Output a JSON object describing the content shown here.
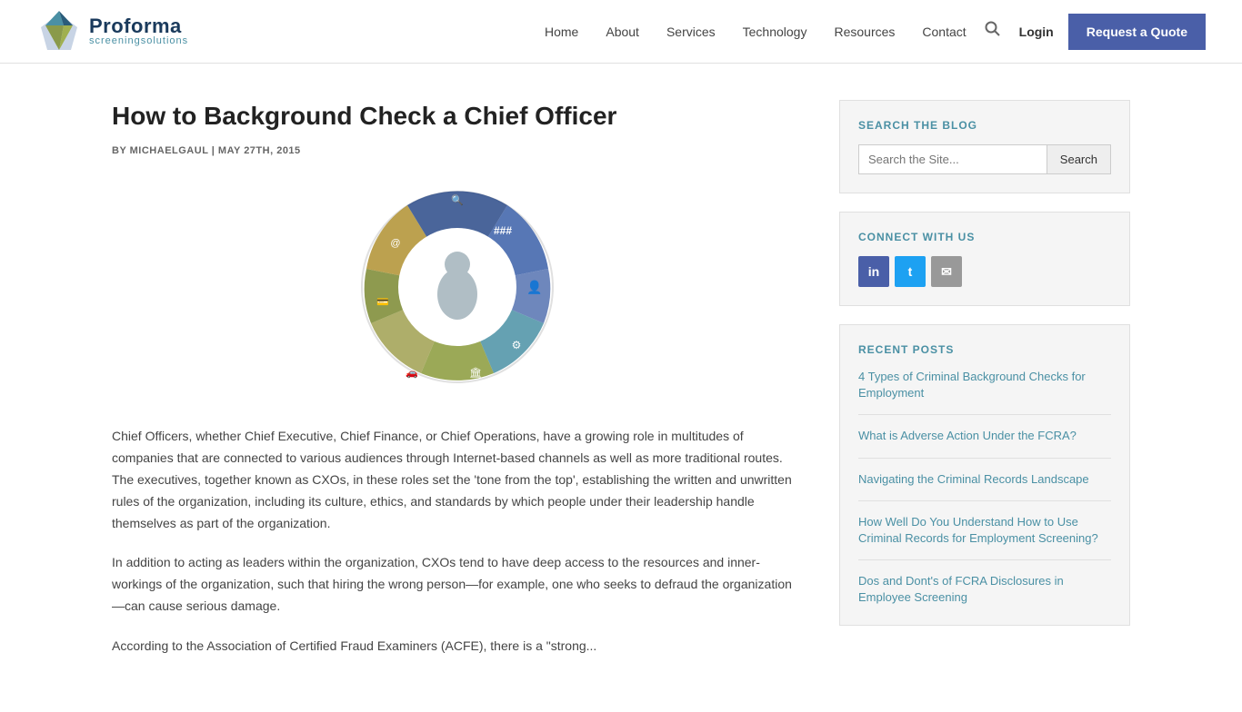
{
  "header": {
    "logo_name": "Proforma",
    "logo_sub_1": "screening",
    "logo_sub_2": "solutions",
    "nav": [
      {
        "label": "Home",
        "href": "#"
      },
      {
        "label": "About",
        "href": "#"
      },
      {
        "label": "Services",
        "href": "#"
      },
      {
        "label": "Technology",
        "href": "#"
      },
      {
        "label": "Resources",
        "href": "#"
      },
      {
        "label": "Contact",
        "href": "#"
      }
    ],
    "login_label": "Login",
    "quote_label": "Request a Quote"
  },
  "article": {
    "title": "How to Background Check a Chief Officer",
    "meta": "BY MICHAELGAUL | MAY 27TH, 2015",
    "body_1": "Chief Officers, whether Chief Executive, Chief Finance, or Chief Operations, have a growing role in multitudes of companies that are connected to various audiences through Internet-based channels as well as more traditional routes. The executives, together known as CXOs, in these roles set the 'tone from the top', establishing the written and unwritten rules of the organization, including its culture, ethics, and standards by which people under their leadership handle themselves as part of the organization.",
    "body_2": "In addition to acting as leaders within the organization, CXOs tend to have deep access to the resources and inner-workings of the organization, such that hiring the wrong person—for example, one who seeks to defraud the organization—can cause serious damage.",
    "body_3": "According to the Association of Certified Fraud Examiners (ACFE), there is a \"strong..."
  },
  "sidebar": {
    "search_section": {
      "title": "SEARCH THE BLOG",
      "placeholder": "Search the Site...",
      "button_label": "Search"
    },
    "connect_section": {
      "title": "CONNECT WITH US",
      "linkedin_label": "in",
      "twitter_label": "t",
      "email_label": "✉"
    },
    "recent_posts_section": {
      "title": "RECENT POSTS",
      "posts": [
        {
          "label": "4 Types of Criminal Background Checks for Employment",
          "href": "#"
        },
        {
          "label": "What is Adverse Action Under the FCRA?",
          "href": "#"
        },
        {
          "label": "Navigating the Criminal Records Landscape",
          "href": "#"
        },
        {
          "label": "How Well Do You Understand How to Use Criminal Records for Employment Screening?",
          "href": "#"
        },
        {
          "label": "Dos and Dont's of FCRA Disclosures in Employee Screening",
          "href": "#"
        }
      ]
    }
  }
}
